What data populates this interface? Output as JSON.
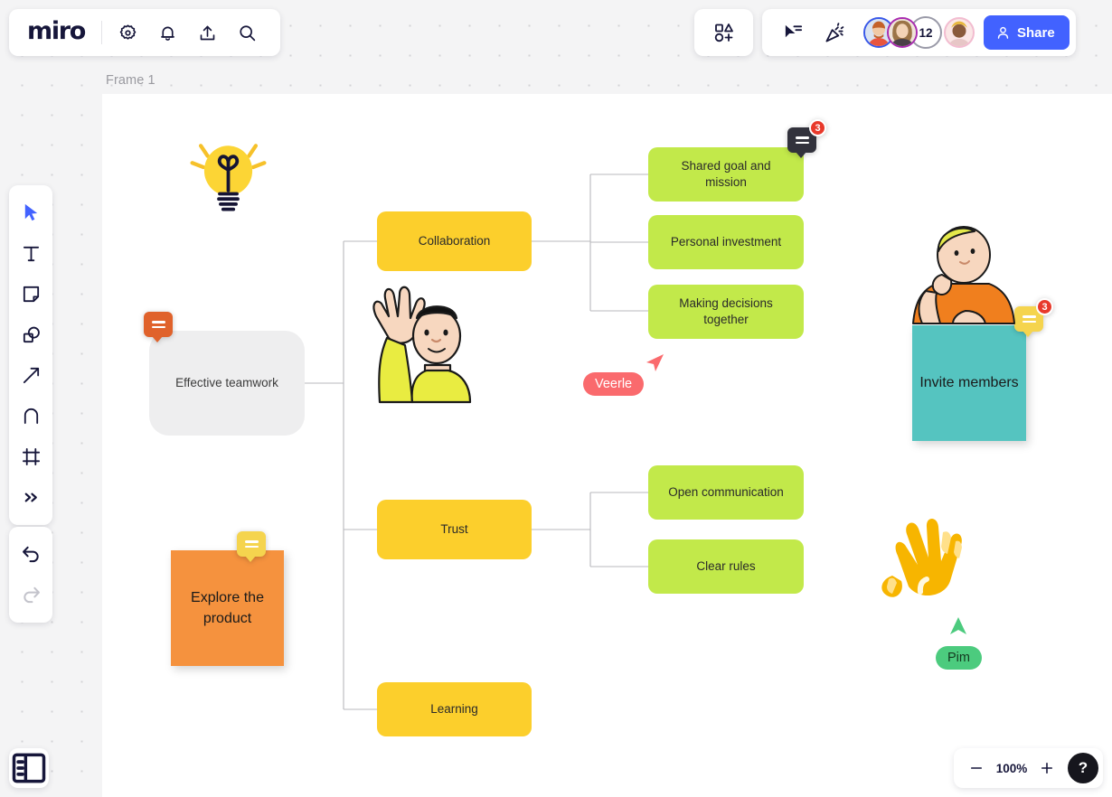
{
  "app": {
    "logo": "miro",
    "frame_label": "Frame 1"
  },
  "header": {
    "icons": [
      {
        "name": "gear-icon",
        "label": "Settings"
      },
      {
        "name": "bell-icon",
        "label": "Notifications"
      },
      {
        "name": "upload-icon",
        "label": "Upload"
      },
      {
        "name": "search-icon",
        "label": "Search"
      }
    ],
    "shapes_button": "Apps and integrations",
    "cursor_button": "Select cursor mode",
    "celebrate_button": "Celebrate",
    "collaborator_count": "12",
    "share_label": "Share"
  },
  "toolbar": {
    "items": [
      {
        "name": "select-tool",
        "label": "Select"
      },
      {
        "name": "text-tool",
        "label": "Text"
      },
      {
        "name": "sticky-note-tool",
        "label": "Sticky note"
      },
      {
        "name": "shapes-tool",
        "label": "Shapes"
      },
      {
        "name": "connector-tool",
        "label": "Connection line"
      },
      {
        "name": "pen-tool",
        "label": "Pen"
      },
      {
        "name": "frame-tool",
        "label": "Frame"
      },
      {
        "name": "more-tools",
        "label": "More tools"
      }
    ],
    "undo_label": "Undo",
    "redo_label": "Redo",
    "panel_toggle_label": "Toggle panel"
  },
  "zoom_controls": {
    "zoom_out_label": "Zoom out",
    "zoom_level": "100%",
    "zoom_in_label": "Zoom in",
    "help_label": "?"
  },
  "mindmap": {
    "root": {
      "label": "Effective teamwork"
    },
    "branches": [
      {
        "label": "Collaboration",
        "children": [
          {
            "label": "Shared goal and mission"
          },
          {
            "label": "Personal investment"
          },
          {
            "label": "Making decisions together"
          }
        ]
      },
      {
        "label": "Trust",
        "children": [
          {
            "label": "Open communication"
          },
          {
            "label": "Clear rules"
          }
        ]
      },
      {
        "label": "Learning",
        "children": []
      }
    ]
  },
  "sticky_notes": [
    {
      "text": "Explore the product",
      "color": "#f5923e"
    },
    {
      "text": "Invite members",
      "color": "#55c4c0"
    }
  ],
  "comments": [
    {
      "name": "comment-badge-root",
      "color": "#e0622b",
      "count": ""
    },
    {
      "name": "comment-badge-explore",
      "color": "#f5d44e",
      "count": ""
    },
    {
      "name": "comment-badge-shared-goal",
      "color": "#32323c",
      "count": "3"
    },
    {
      "name": "comment-badge-invite",
      "color": "#f5d44e",
      "count": "3"
    }
  ],
  "collaborator_cursors": [
    {
      "name": "Veerle",
      "color": "#fa6a6d"
    },
    {
      "name": "Pim",
      "color": "#4ccb7e"
    }
  ],
  "stickers": [
    {
      "name": "lightbulb-sticker"
    },
    {
      "name": "waving-person-sticker"
    },
    {
      "name": "thinking-person-sticker"
    },
    {
      "name": "waving-hand-sticker"
    }
  ],
  "colors": {
    "brand_blue": "#4262ff",
    "node_level1": "#fccf2c",
    "node_level2": "#c2e94a",
    "node_root": "#eeeeef",
    "badge_red": "#e8392b"
  }
}
